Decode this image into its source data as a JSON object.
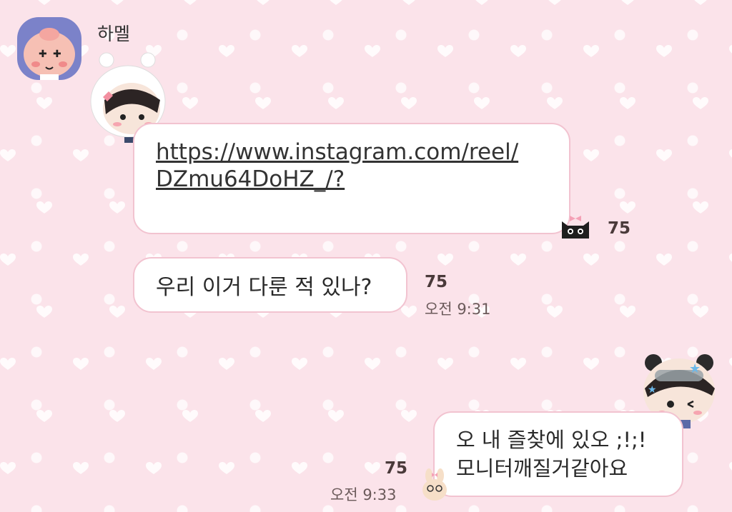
{
  "chat": {
    "sender_name": "하멜",
    "messages": [
      {
        "text": "https://www.instagram.com/reel/DZmu64DoHZ_/?",
        "text_line1": "https://www.instagram.com/reel/",
        "text_line2": "DZmu64DoHZ_/?",
        "unread": "75"
      },
      {
        "text": "우리 이거 다룬 적 있나?",
        "unread": "75",
        "time": "오전 9:31"
      },
      {
        "text_line1": "오 내 즐찾에 있오 ;!;!",
        "text_line2": "모니터깨질거같아요",
        "unread": "75",
        "time": "오전 9:33"
      }
    ]
  },
  "icons": {
    "avatar": "peach-character-avatar",
    "sticker1": "hooded-boy-sticker-icon",
    "sticker2": "black-cat-with-bow-icon",
    "sticker3": "boy-with-goggles-sticker-icon",
    "sticker4": "bunny-with-glasses-icon"
  },
  "colors": {
    "background": "#fbe3ea",
    "bubble_border": "#f2c3d0",
    "avatar_bg": "#7b82c9"
  }
}
